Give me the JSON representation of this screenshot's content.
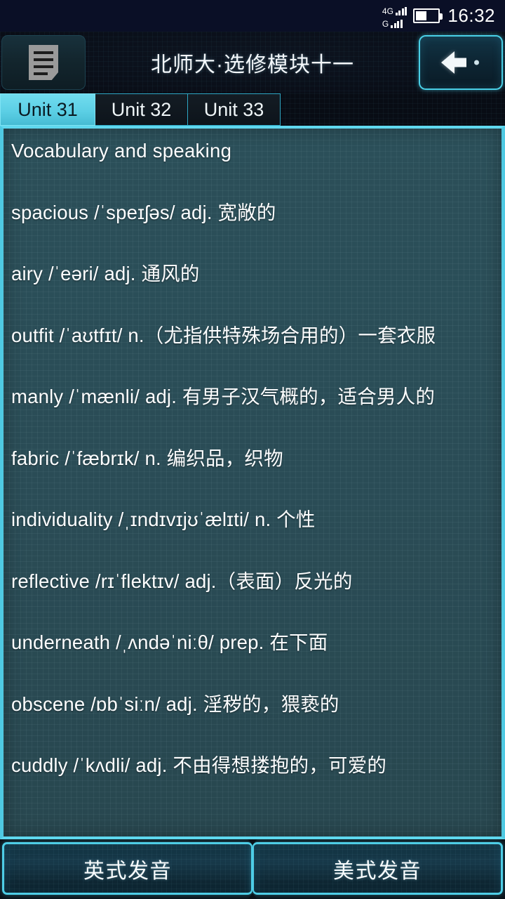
{
  "statusbar": {
    "sim1_network": "4G",
    "sim2_network": "G",
    "signal_icon": "signal-bars-icon",
    "battery_icon": "battery-icon",
    "battery_level_percent": 50,
    "time": "16:32"
  },
  "titlebar": {
    "menu_icon": "document-lines-icon",
    "title": "北师大·选修模块十一",
    "back_icon": "back-arrow-icon"
  },
  "tabs": [
    {
      "label": "Unit 31",
      "active": true
    },
    {
      "label": "Unit 32",
      "active": false
    },
    {
      "label": "Unit 33",
      "active": false
    }
  ],
  "content": {
    "heading": "Vocabulary and speaking",
    "entries": [
      "spacious  /ˈspeɪʃəs/   adj. 宽敞的",
      "airy  /ˈeəri/   adj. 通风的",
      "outfit  /ˈaʊtfɪt/  n.（尤指供特殊场合用的）一套衣服",
      "manly  /ˈmænli/   adj. 有男子汉气概的，适合男人的",
      "fabric  /ˈfæbrɪk/  n. 编织品，织物",
      "individuality  /ˌɪndɪvɪjʊˈælɪti/  n. 个性",
      "reflective  /rɪˈflektɪv/   adj.（表面）反光的",
      "underneath  /ˌʌndəˈniːθ/  prep. 在下面",
      "obscene  /ɒbˈsiːn/   adj. 淫秽的，猥亵的",
      "cuddly  /ˈkʌdli/   adj. 不由得想搂抱的，可爱的"
    ]
  },
  "footer": {
    "british_button": "英式发音",
    "american_button": "美式发音"
  },
  "colors": {
    "accent_cyan": "#5fd8ef",
    "active_tab": "#5ccfe5",
    "panel_bg": "#2a4c56",
    "status_bg": "#0a0f26"
  }
}
